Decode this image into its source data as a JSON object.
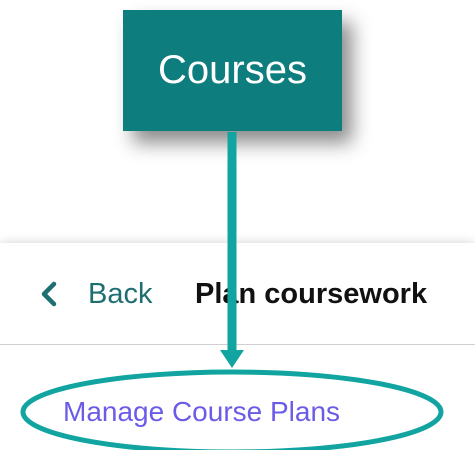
{
  "callout": {
    "label": "Courses"
  },
  "header": {
    "back_label": "Back",
    "title": "Plan coursework"
  },
  "menu": {
    "manage_label": "Manage Course Plans"
  },
  "colors": {
    "accent_teal": "#0d7d7e",
    "arrow_teal": "#12a4a0",
    "link_purple": "#6b5ce7",
    "back_text": "#1f6f70"
  },
  "icons": {
    "back": "chevron-left-icon",
    "pointer": "arrow-down-icon",
    "highlight": "ellipse-highlight"
  }
}
